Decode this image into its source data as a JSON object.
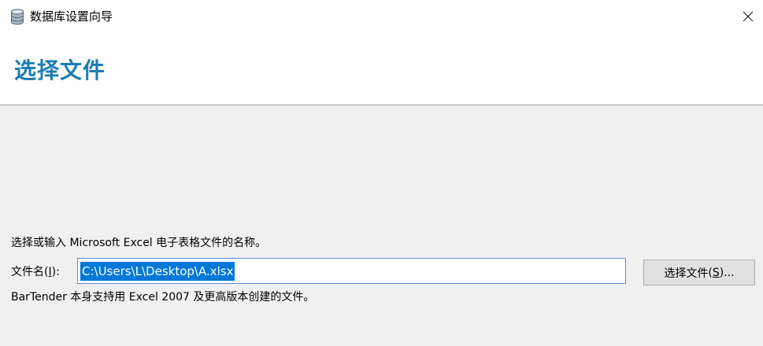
{
  "window": {
    "title": "数据库设置向导",
    "icon": "database-icon",
    "close_icon": "close-icon"
  },
  "page": {
    "heading": "选择文件",
    "heading_color": "#1c7cb4"
  },
  "form": {
    "instruction": "选择或输入 Microsoft Excel 电子表格文件的名称。",
    "filename_label": "文件名",
    "filename_label_hotkey": "I",
    "filename_value": "C:\\Users\\L\\Desktop\\A.xlsx",
    "browse_button_label": "选择文件",
    "browse_button_hotkey": "S",
    "support_note": "BarTender 本身支持用 Excel 2007 及更高版本创建的文件。"
  }
}
